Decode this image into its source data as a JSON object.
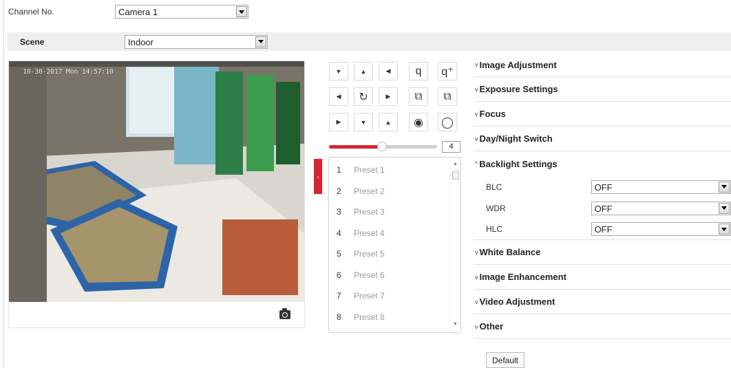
{
  "channel": {
    "label": "Channel No.",
    "value": "Camera 1"
  },
  "scene": {
    "label": "Scene",
    "value": "Indoor"
  },
  "video": {
    "osd_text": "10-30-2017 Mon 14:57:10"
  },
  "ptz": {
    "speed_value": "4",
    "speed_fraction": 0.49
  },
  "presets": [
    {
      "num": "1",
      "name": "Preset 1"
    },
    {
      "num": "2",
      "name": "Preset 2"
    },
    {
      "num": "3",
      "name": "Preset 3"
    },
    {
      "num": "4",
      "name": "Preset 4"
    },
    {
      "num": "5",
      "name": "Preset 5"
    },
    {
      "num": "6",
      "name": "Preset 6"
    },
    {
      "num": "7",
      "name": "Preset 7"
    },
    {
      "num": "8",
      "name": "Preset 8"
    }
  ],
  "settings": {
    "image_adjustment": "Image Adjustment",
    "exposure_settings": "Exposure Settings",
    "focus": "Focus",
    "day_night_switch": "Day/Night Switch",
    "backlight_settings": "Backlight Settings",
    "blc": {
      "label": "BLC",
      "value": "OFF"
    },
    "wdr": {
      "label": "WDR",
      "value": "OFF"
    },
    "hlc": {
      "label": "HLC",
      "value": "OFF"
    },
    "white_balance": "White Balance",
    "image_enhancement": "Image Enhancement",
    "video_adjustment": "Video Adjustment",
    "other": "Other"
  },
  "default_button": "Default",
  "colors": {
    "accent": "#d9232d",
    "section_bg": "#efefef"
  }
}
